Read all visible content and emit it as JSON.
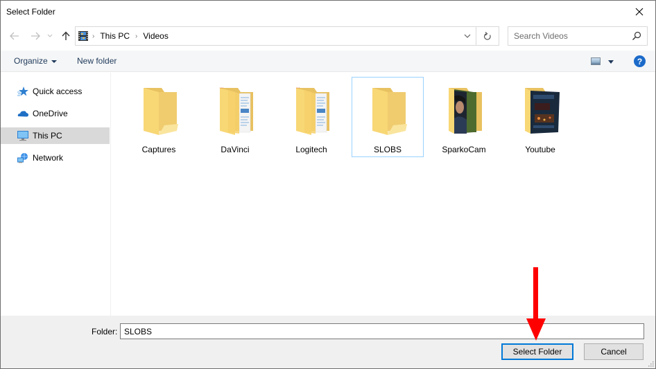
{
  "window": {
    "title": "Select Folder",
    "close_icon": "close-icon"
  },
  "navigation": {
    "back_icon": "arrow-left-icon",
    "forward_icon": "arrow-right-icon",
    "recent_icon": "chevron-down-icon",
    "up_icon": "arrow-up-icon",
    "breadcrumb": [
      "This PC",
      "Videos"
    ],
    "location_icon": "videos-library-icon",
    "dropdown_icon": "chevron-down-icon",
    "refresh_icon": "refresh-icon"
  },
  "search": {
    "placeholder": "Search Videos",
    "icon": "search-icon"
  },
  "toolbar": {
    "organize_label": "Organize",
    "new_folder_label": "New folder",
    "view_icon": "change-view-icon",
    "help_icon": "help-icon",
    "help_glyph": "?"
  },
  "sidebar": {
    "items": [
      {
        "label": "Quick access",
        "icon": "star-icon",
        "selected": false
      },
      {
        "label": "OneDrive",
        "icon": "cloud-icon",
        "selected": false
      },
      {
        "label": "This PC",
        "icon": "computer-icon",
        "selected": true
      },
      {
        "label": "Network",
        "icon": "network-icon",
        "selected": false
      }
    ]
  },
  "folders": [
    {
      "name": "Captures",
      "type": "empty",
      "selected": false
    },
    {
      "name": "DaVinci",
      "type": "documents",
      "selected": false
    },
    {
      "name": "Logitech",
      "type": "documents",
      "selected": false
    },
    {
      "name": "SLOBS",
      "type": "empty",
      "selected": true
    },
    {
      "name": "SparkoCam",
      "type": "photo-person",
      "selected": false
    },
    {
      "name": "Youtube",
      "type": "photo-dark",
      "selected": false
    }
  ],
  "footer": {
    "folder_label": "Folder:",
    "folder_value": "SLOBS",
    "select_button": "Select Folder",
    "cancel_button": "Cancel"
  },
  "annotation": {
    "arrow_color": "#ff0000",
    "points_to": "Select Folder"
  },
  "colors": {
    "accent": "#0078d7",
    "selection_border": "#99d1ff",
    "folder_yellow": "#f8d775",
    "help_blue": "#1b6ac9"
  }
}
